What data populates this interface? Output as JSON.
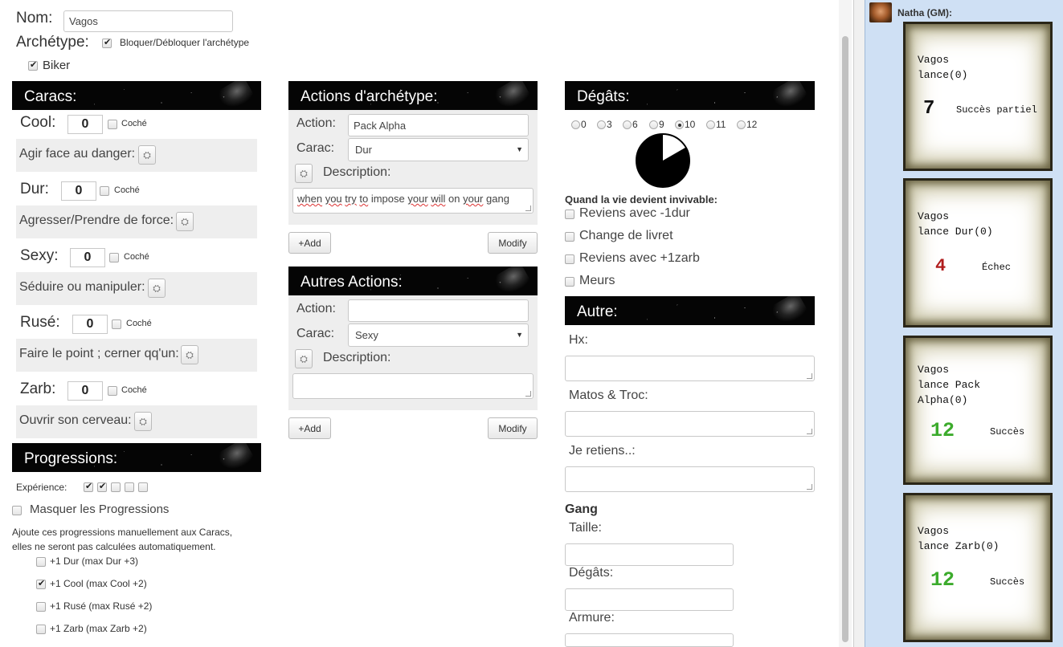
{
  "identity": {
    "nom_label": "Nom:",
    "nom_value": "Vagos",
    "archetype_label": "Archétype:",
    "lock_label": "Bloquer/Débloquer l'archétype",
    "archetype_value": "Biker"
  },
  "caracs": {
    "title": "Caracs:",
    "checked_label": "Coché",
    "items": [
      {
        "name": "Cool:",
        "value": "0",
        "move": "Agir face au danger:"
      },
      {
        "name": "Dur:",
        "value": "0",
        "move": "Agresser/Prendre de force:"
      },
      {
        "name": "Sexy:",
        "value": "0",
        "move": "Séduire ou manipuler:"
      },
      {
        "name": "Rusé:",
        "value": "0",
        "move": "Faire le point ; cerner qq'un:"
      },
      {
        "name": "Zarb:",
        "value": "0",
        "move": "Ouvrir son cerveau:"
      }
    ]
  },
  "progressions": {
    "title": "Progressions:",
    "experience_label": "Expérience:",
    "experience_checks": [
      true,
      true,
      false,
      false,
      false
    ],
    "hide_label": "Masquer les Progressions",
    "note_line1": "Ajoute ces progressions manuellement aux Caracs,",
    "note_line2": "elles ne seront pas calculées automatiquement.",
    "items": [
      {
        "label": "+1 Dur (max Dur +3)",
        "checked": false
      },
      {
        "label": "+1 Cool (max Cool +2)",
        "checked": true
      },
      {
        "label": "+1 Rusé (max Rusé +2)",
        "checked": false
      },
      {
        "label": "+1 Zarb (max Zarb +2)",
        "checked": false
      }
    ]
  },
  "archetype_actions": {
    "title": "Actions d'archétype:",
    "action_label": "Action:",
    "action_value": "Pack Alpha",
    "carac_label": "Carac:",
    "carac_value": "Dur",
    "description_label": "Description:",
    "description_words": [
      "when",
      "you",
      "try",
      "to",
      "impose",
      "your",
      "will",
      "on",
      "your",
      "gang"
    ],
    "add_label": "+Add",
    "modify_label": "Modify"
  },
  "other_actions": {
    "title": "Autres Actions:",
    "action_label": "Action:",
    "action_value": "",
    "carac_label": "Carac:",
    "carac_value": "Sexy",
    "description_label": "Description:",
    "description_value": "",
    "add_label": "+Add",
    "modify_label": "Modify"
  },
  "degats": {
    "title": "Dégâts:",
    "options": [
      "0",
      "3",
      "6",
      "9",
      "10",
      "11",
      "12"
    ],
    "selected": "10",
    "selected_fraction": 0.833,
    "heading": "Quand la vie devient invivable:",
    "items": [
      "Reviens avec -1dur",
      "Change de livret",
      "Reviens avec +1zarb",
      "Meurs"
    ]
  },
  "autre": {
    "title": "Autre:",
    "hx_label": "Hx:",
    "matos_label": "Matos & Troc:",
    "retiens_label": "Je retiens..:"
  },
  "gang": {
    "title": "Gang",
    "taille_label": "Taille:",
    "degats_label": "Dégâts:",
    "armure_label": "Armure:"
  },
  "chat": {
    "sender": "Natha (GM):",
    "cards": [
      {
        "line1": "Vagos",
        "line2": "lance(0)",
        "line3": "",
        "result": "7",
        "verdict": "Succès partiel",
        "color": "#111111"
      },
      {
        "line1": "Vagos",
        "line2": "lance Dur(0)",
        "line3": "",
        "result": "4",
        "verdict": "Échec",
        "color": "#b01c1c"
      },
      {
        "line1": "Vagos",
        "line2": "lance Pack",
        "line3": "Alpha(0)",
        "result": "12",
        "verdict": "Succès",
        "color": "#3cab2c"
      },
      {
        "line1": "Vagos",
        "line2": "lance Zarb(0)",
        "line3": "",
        "result": "12",
        "verdict": "Succès",
        "color": "#3cab2c"
      }
    ]
  }
}
